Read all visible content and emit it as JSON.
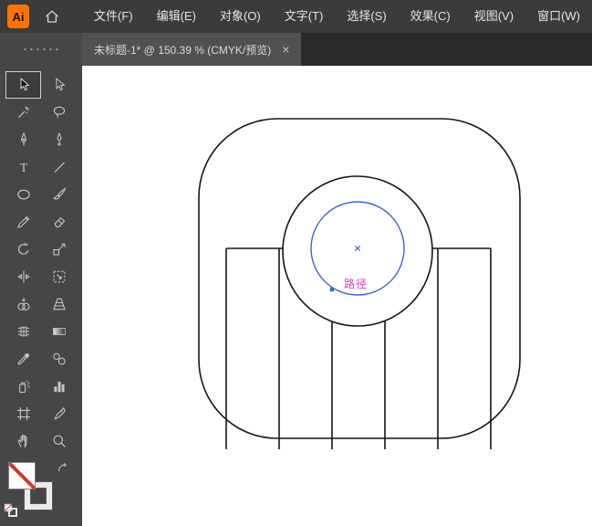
{
  "menubar": {
    "logo_text": "Ai",
    "items": [
      {
        "label": "文件(F)"
      },
      {
        "label": "编辑(E)"
      },
      {
        "label": "对象(O)"
      },
      {
        "label": "文字(T)"
      },
      {
        "label": "选择(S)"
      },
      {
        "label": "效果(C)"
      },
      {
        "label": "视图(V)"
      },
      {
        "label": "窗口(W)"
      }
    ]
  },
  "tabbar": {
    "active_tab": {
      "title": "未标题-1* @ 150.39 % (CMYK/预览)",
      "document_name": "未标题-1*",
      "zoom_level": "150.39 %",
      "color_mode": "CMYK/预览",
      "close_glyph": "×"
    }
  },
  "toolbar": {
    "active_tool": "selection",
    "type_glyph": "T",
    "tools": [
      "selection",
      "direct-selection",
      "magic-wand",
      "lasso",
      "pen",
      "curvature",
      "type",
      "line-segment",
      "ellipse",
      "paintbrush",
      "pencil",
      "eraser",
      "rotate",
      "scale",
      "width",
      "free-transform",
      "shape-builder",
      "perspective-grid",
      "mesh",
      "gradient",
      "eyedropper",
      "blend",
      "symbol-sprayer",
      "column-graph",
      "artboard",
      "slice",
      "hand",
      "zoom"
    ]
  },
  "canvas": {
    "smart_guide_label": "路径",
    "colors": {
      "artwork_outline": "#161616",
      "selection_blue": "#3e63cf",
      "label_magenta": "#e23bd0",
      "canvas_bg": "#ffffff"
    }
  }
}
